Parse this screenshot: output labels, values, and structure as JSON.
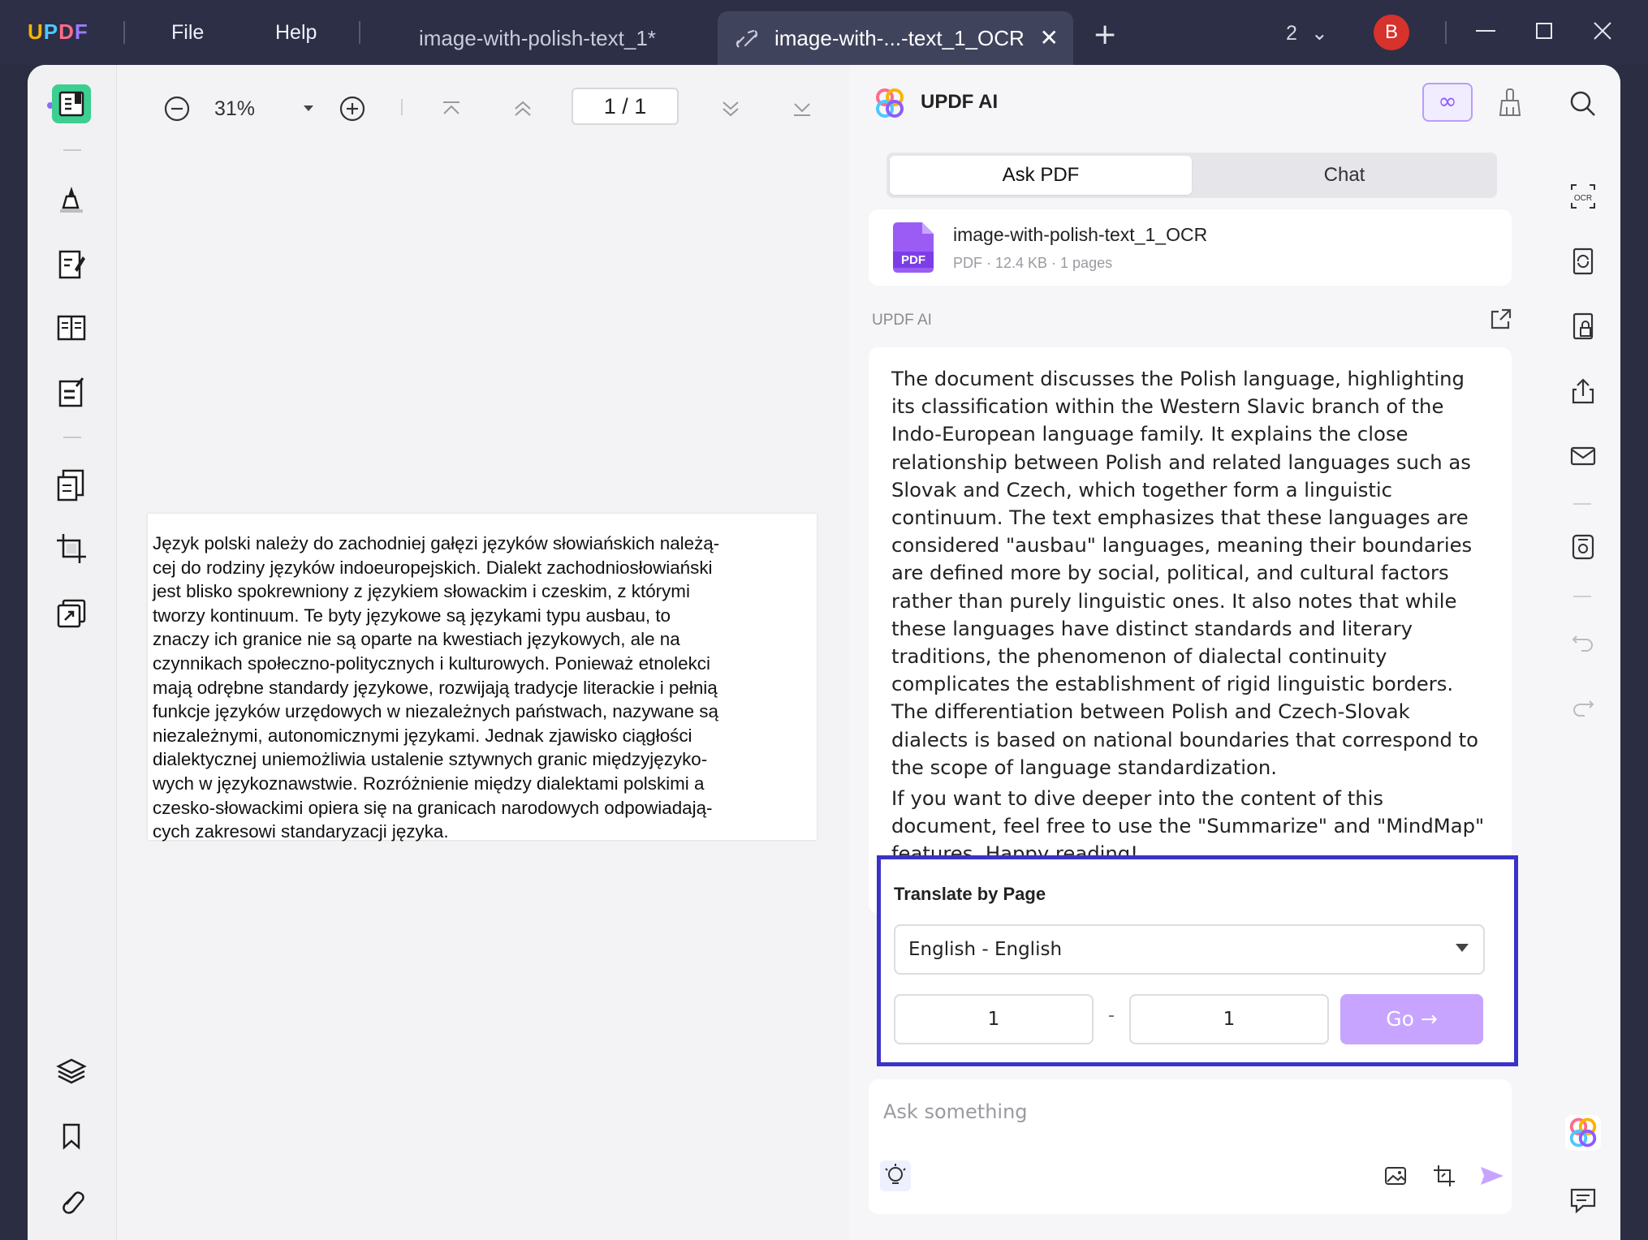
{
  "app": {
    "logo": "UPDF",
    "menu": [
      "File",
      "Help"
    ],
    "tabs": [
      {
        "label": "image-with-polish-text_1*",
        "active": false
      },
      {
        "label": "image-with-...-text_1_OCR",
        "active": true
      }
    ],
    "tab_count": "2",
    "avatar_initial": "B"
  },
  "viewer": {
    "zoom": "31%",
    "page_indicator": "1 / 1",
    "page_text": "Język polski należy do zachodniej gałęzi języków słowiańskich należą-\ncej do rodziny języków indoeuropejskich. Dialekt zachodniosłowiański\njest blisko spokrewniony z językiem słowackim i czeskim, z którymi\ntworzy kontinuum. Te byty językowe są językami typu ausbau, to\nznaczy ich granice nie są oparte na kwestiach językowych, ale na\nczynnikach społeczno-politycznych i kulturowych. Ponieważ etnolekci\nmają odrębne standardy językowe, rozwijają tradycje literackie i pełnią\nfunkcje języków urzędowych w niezależnych państwach, nazywane są\nniezależnymi, autonomicznymi językami. Jednak zjawisko ciągłości\ndialektycznej uniemożliwia ustalenie sztywnych granic międzyjęzyko-\nwych w językoznawstwie. Rozróżnienie między dialektami polskimi a\nczesko-słowackimi opiera się na granicach narodowych odpowiadają-\ncych zakresowi standaryzacji języka."
  },
  "ai": {
    "title": "UPDF AI",
    "tabs": {
      "ask_pdf": "Ask PDF",
      "chat": "Chat"
    },
    "file": {
      "icon_label": "PDF",
      "name": "image-with-polish-text_1_OCR",
      "meta": "PDF · 12.4 KB · 1 pages"
    },
    "label": "UPDF AI",
    "answer_p1": "The document discusses the Polish language, highlighting its classification within the Western Slavic branch of the Indo-European language family. It explains the close relationship between Polish and related languages such as Slovak and Czech, which together form a linguistic continuum. The text emphasizes that these languages are considered \"ausbau\" languages, meaning their boundaries are defined more by social, political, and cultural factors rather than purely linguistic ones. It also notes that while these languages have distinct standards and literary traditions, the phenomenon of dialectal continuity complicates the establishment of rigid linguistic borders. The differentiation between Polish and Czech-Slovak dialects is based on national boundaries that correspond to the scope of language standardization.",
    "answer_p2": "If you want to dive deeper into the content of this document, feel free to use the \"Summarize\" and \"MindMap\" features. Happy reading!",
    "translate": {
      "title": "Translate by Page",
      "language": "English - English",
      "from_page": "1",
      "separator": "-",
      "to_page": "1",
      "go_label": "Go →"
    },
    "ask_placeholder": "Ask something"
  },
  "colors": {
    "titlebar": "#2c2f46",
    "accent": "#8a5cff",
    "highlight_border": "#3b33c7",
    "go_button": "#c6a4ff",
    "avatar": "#d7322b"
  }
}
